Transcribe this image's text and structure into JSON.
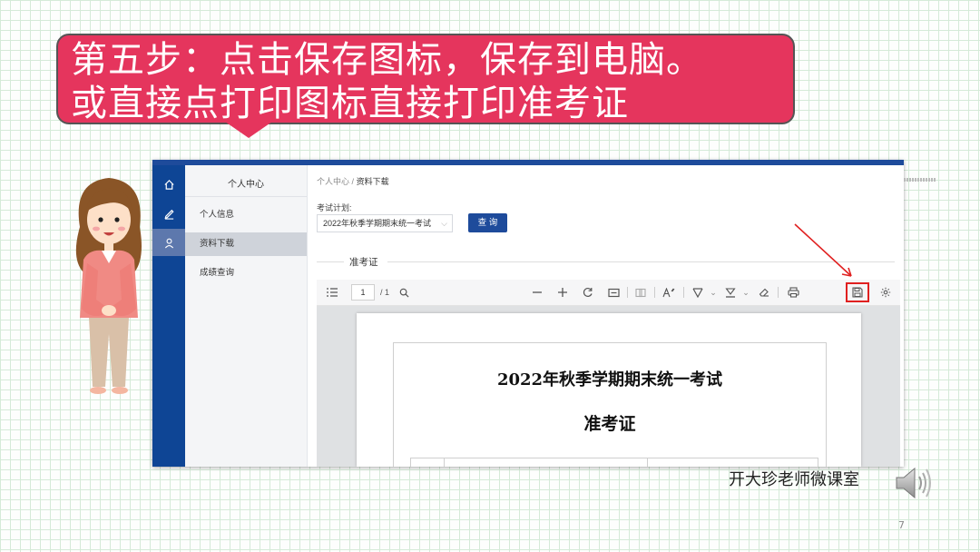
{
  "callout": {
    "line1": "第五步：点击保存图标，保存到电脑。",
    "line2": "或直接点打印图标直接打印准考证",
    "color": "#e5355d"
  },
  "rail": {
    "icons": [
      "home-icon",
      "edit-icon",
      "user-icon"
    ],
    "active_index": 2
  },
  "menu": {
    "title": "个人中心",
    "items": [
      {
        "label": "个人信息",
        "active": false
      },
      {
        "label": "资料下载",
        "active": true
      },
      {
        "label": "成绩查询",
        "active": false
      }
    ]
  },
  "breadcrumb": {
    "parent": "个人中心",
    "separator": "/",
    "current": "资料下载"
  },
  "form": {
    "plan_label": "考试计划:",
    "plan_value": "2022年秋季学期期末统一考试",
    "query_button": "查 询"
  },
  "section": {
    "title": "准考证"
  },
  "pdf_toolbar": {
    "page_current": "1",
    "page_total": "/ 1",
    "icons": [
      "outline-icon",
      "search-icon",
      "zoom-out-icon",
      "zoom-in-icon",
      "rotate-icon",
      "fit-icon",
      "page-view-icon",
      "text-size-icon",
      "draw-icon",
      "highlight-icon",
      "eraser-icon",
      "print-icon",
      "save-icon",
      "settings-icon"
    ],
    "highlighted_icon": "save-icon"
  },
  "pdf": {
    "title": "2022年秋季学期期末统一考试",
    "subtitle": "准考证"
  },
  "watermark": "开大珍老师微课室",
  "slide_number": "7",
  "colors": {
    "accent_blue": "#1e4b9b",
    "highlight_red": "#e02020"
  }
}
